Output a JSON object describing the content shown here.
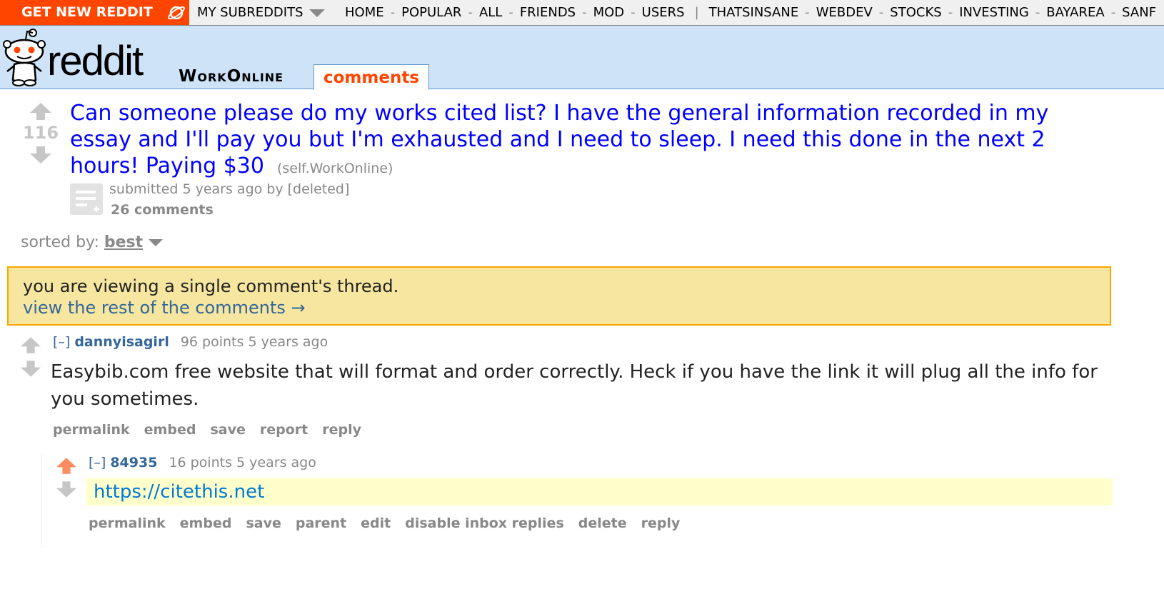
{
  "topbar": {
    "get_new": "GET NEW REDDIT",
    "my_subreddits": "MY SUBREDDITS",
    "nav_main": [
      "HOME",
      "POPULAR",
      "ALL",
      "FRIENDS",
      "MOD",
      "USERS"
    ],
    "nav_subs": [
      "THATSINSANE",
      "WEBDEV",
      "STOCKS",
      "INVESTING",
      "BAYAREA",
      "SANF"
    ]
  },
  "header": {
    "logo_text": "reddit",
    "subreddit": "WorkOnline",
    "tab": "comments"
  },
  "post": {
    "score": "116",
    "title": "Can someone please do my works cited list? I have the general information recorded in my essay and I'll pay you but I'm exhausted and I need to sleep. I need this done in the next 2 hours! Paying $30",
    "domain": "(self.WorkOnline)",
    "tagline": "submitted 5 years ago by [deleted]",
    "comments": "26 comments"
  },
  "sort": {
    "label": "sorted by:",
    "value": "best"
  },
  "notice": {
    "text": "you are viewing a single comment's thread.",
    "link": "view the rest of the comments →"
  },
  "comments": [
    {
      "expand": "[–]",
      "author": "dannyisagirl",
      "meta": "96 points 5 years ago",
      "body": "Easybib.com free website that will format and order correctly. Heck if you have the link it will plug all the info for you sometimes.",
      "buttons": [
        "permalink",
        "embed",
        "save",
        "report",
        "reply"
      ]
    },
    {
      "expand": "[–]",
      "author": "84935",
      "meta": "16 points 5 years ago",
      "body": "https://citethis.net",
      "buttons": [
        "permalink",
        "embed",
        "save",
        "parent",
        "edit",
        "disable inbox replies",
        "delete",
        "reply"
      ]
    }
  ],
  "colors": {
    "accent": "#ff4500",
    "header_bg": "#cee3f8",
    "link_blue": "#336699",
    "notice_bg": "#f6e69f",
    "upvoted": "#ff8b60"
  }
}
